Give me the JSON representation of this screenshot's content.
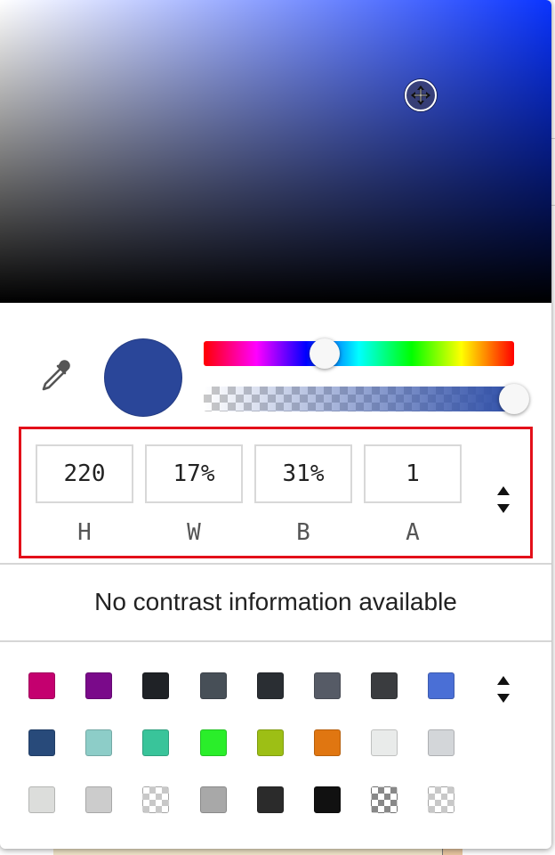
{
  "color": {
    "hue_hex": "#0a34ff",
    "swatch_hex": "#2a4699",
    "alpha_end_hex": "#2f4fa8"
  },
  "hue_slider_value": 220,
  "alpha_slider_value": 1,
  "values": [
    {
      "value": "220",
      "label": "H"
    },
    {
      "value": "17%",
      "label": "W"
    },
    {
      "value": "31%",
      "label": "B"
    },
    {
      "value": "1",
      "label": "A"
    }
  ],
  "contrast": {
    "text": "No contrast information available"
  },
  "palette": {
    "swatches": [
      "#c4006f",
      "#7a0a8a",
      "#1f2226",
      "#474f57",
      "#2a2e33",
      "#565b66",
      "#3a3c3f",
      "#4a6fd6",
      "#284a7a",
      "#8dcdc8",
      "#39c49a",
      "#2aee2a",
      "#9dbf15",
      "#e07611",
      "#e9ebea",
      "#d3d6d9",
      "#dcdddb",
      "#cccccc",
      "checker",
      "#a8a8a8",
      "#2b2b2b",
      "#111111",
      "checker-dark",
      "checker"
    ]
  },
  "icons": {
    "eyedropper": "eyedropper-icon",
    "move": "move-cursor-icon",
    "format_toggle": "up-down-arrows-icon",
    "palette_toggle": "up-down-arrows-icon"
  }
}
